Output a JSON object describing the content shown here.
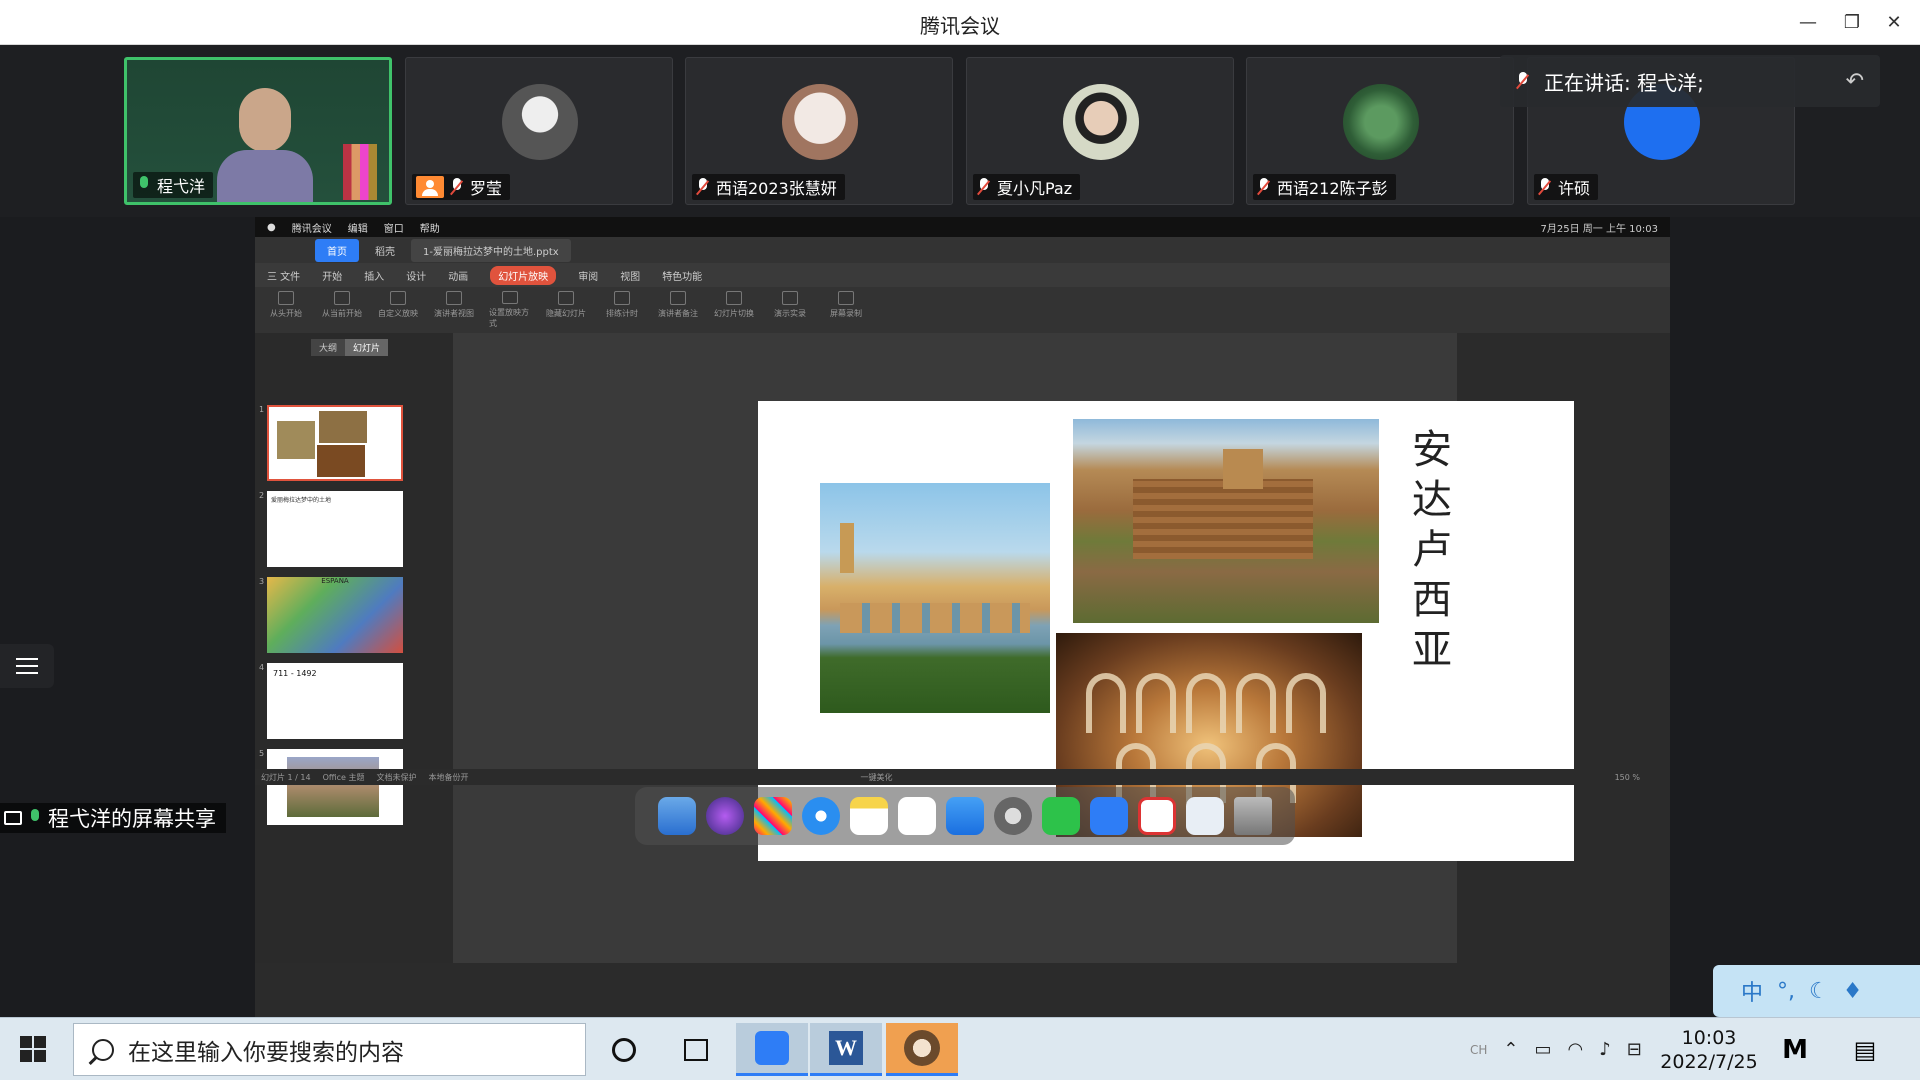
{
  "window": {
    "title": "腾讯会议"
  },
  "participants": [
    {
      "name": "程弋洋",
      "mic": "on",
      "active": true
    },
    {
      "name": "罗莹",
      "mic": "muted",
      "avatar_color": "#777777"
    },
    {
      "name": "西语2023张慧妍",
      "mic": "muted",
      "avatar_color": "#e8e0dc"
    },
    {
      "name": "夏小凡Paz",
      "mic": "muted",
      "avatar_color": "#cfd3c2"
    },
    {
      "name": "西语212陈子彭",
      "mic": "muted",
      "avatar_color": "#3d6e45"
    },
    {
      "name": "许硕",
      "mic": "muted",
      "avatar_color": "#1e6ff0"
    }
  ],
  "speaking": {
    "text": "正在讲话: 程弋洋;"
  },
  "shared_screen": {
    "mac_menu": [
      "腾讯会议",
      "编辑",
      "窗口",
      "帮助"
    ],
    "mac_status_right": "7月25日 周一 上午 10:03",
    "app_tabs": [
      "首页",
      "稻壳",
      "1-爱丽梅拉达梦中的土地.pptx"
    ],
    "ribbon_menu": [
      "三 文件",
      "开始",
      "插入",
      "设计",
      "动画",
      "幻灯片放映",
      "审阅",
      "视图",
      "特色功能"
    ],
    "ribbon_buttons": [
      "从头开始",
      "从当前开始",
      "自定义放映",
      "演讲者视图",
      "设置放映方式",
      "隐藏幻灯片",
      "排练计时",
      "演讲者备注",
      "幻灯片切换",
      "演示实录",
      "屏幕录制"
    ],
    "panel_tabs": [
      "大纲",
      "幻灯片"
    ],
    "slide_title": "安达卢西亚",
    "thumb2_title": "爱丽梅拉达梦中的土地",
    "thumb3_title": "ESPAÑA",
    "thumb4_title": "711 - 1492",
    "status_left": "幻灯片 1 / 14",
    "status_theme": "Office 主题",
    "status_doc": "文档未保护",
    "status_backup": "本地备份开",
    "status_beautify": "一键美化",
    "zoom": "150 %"
  },
  "share_label": "程弋洋的屏幕共享",
  "ime": {
    "lang": "中"
  },
  "taskbar": {
    "search_placeholder": "在这里输入你要搜索的内容",
    "time": "10:03",
    "date": "2022/7/25",
    "lang": "CH"
  }
}
